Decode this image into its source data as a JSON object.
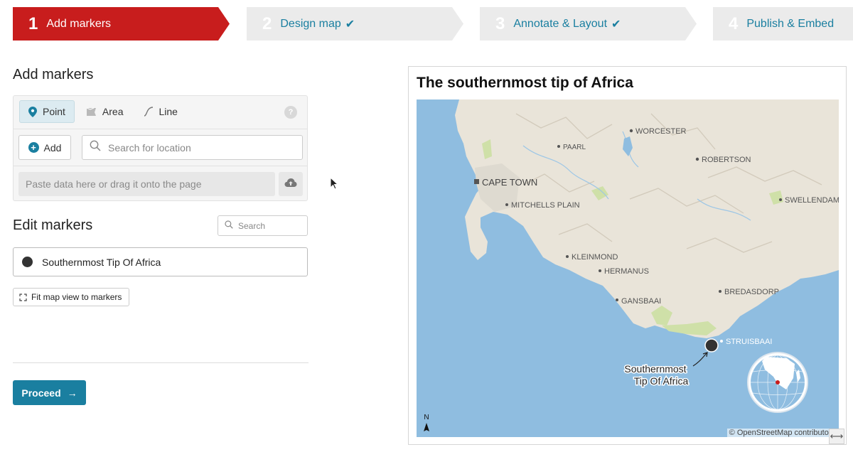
{
  "steps": [
    {
      "num": "1",
      "label": "Add markers",
      "checked": false
    },
    {
      "num": "2",
      "label": "Design map",
      "checked": true
    },
    {
      "num": "3",
      "label": "Annotate & Layout",
      "checked": true
    },
    {
      "num": "4",
      "label": "Publish & Embed",
      "checked": false
    }
  ],
  "check_mark": "✔",
  "add_markers": {
    "title": "Add markers",
    "tabs": {
      "point": "Point",
      "area": "Area",
      "line": "Line"
    },
    "help": "?",
    "add_button": "Add",
    "search_placeholder": "Search for location",
    "paste_text": "Paste data here or drag it onto the page"
  },
  "edit_markers": {
    "title": "Edit markers",
    "search_placeholder": "Search",
    "marker_name": "Southernmost Tip Of Africa",
    "fit_button": "Fit map view to markers"
  },
  "proceed": {
    "label": "Proceed",
    "arrow": "→"
  },
  "map": {
    "title": "The southernmost tip of Africa",
    "places": {
      "worcester": "WORCESTER",
      "paarl": "PAARL",
      "robertson": "ROBERTSON",
      "cape_town": "CAPE TOWN",
      "mitchells_plain": "MITCHELLS PLAIN",
      "swellendam": "SWELLENDAM",
      "kleinmond": "KLEINMOND",
      "hermanus": "HERMANUS",
      "bredasdorp": "BREDASDORP",
      "gansbaai": "GANSBAAI",
      "struisbaai": "STRUISBAAI"
    },
    "marker_label_line1": "Southernmost",
    "marker_label_line2": "Tip Of Africa",
    "north_label": "N",
    "attribution": "© OpenStreetMap contributors",
    "colors": {
      "sea": "#8fbde0",
      "land": "#e9e4d9",
      "green": "#cfe0a8",
      "accent": "#c81d1d",
      "teal": "#1a7fa0"
    }
  },
  "resize_icon": "⟷"
}
